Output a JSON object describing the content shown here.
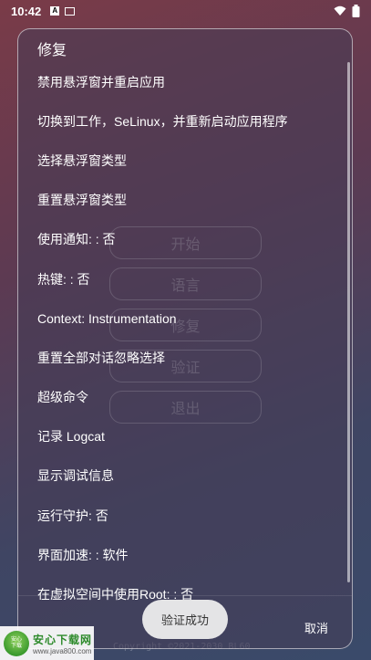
{
  "status_bar": {
    "time": "10:42",
    "icon_a": "A",
    "icons": [
      "notification-a-icon",
      "screenshot-icon",
      "wifi-icon",
      "battery-icon"
    ]
  },
  "background": {
    "buttons": [
      "开始",
      "语言",
      "修复",
      "验证",
      "退出"
    ],
    "copyright": "Copyright ©2021-2030 BL60"
  },
  "dialog": {
    "title": "修复",
    "items": [
      "禁用悬浮窗并重启应用",
      "切换到工作，SeLinux，并重新启动应用程序",
      "选择悬浮窗类型",
      "重置悬浮窗类型",
      "使用通知: : 否",
      "热键: : 否",
      "Context: Instrumentation",
      "重置全部对话忽略选择",
      "超级命令",
      "记录 Logcat",
      "显示调试信息",
      "运行守护: 否",
      "界面加速: : 软件",
      "在虚拟空间中使用Root: : 否"
    ],
    "cancel_label": "取消"
  },
  "toast": {
    "text": "验证成功"
  },
  "watermark": {
    "logo_text": "安心\n下载",
    "name": "安心下载网",
    "url": "www.java800.com"
  }
}
